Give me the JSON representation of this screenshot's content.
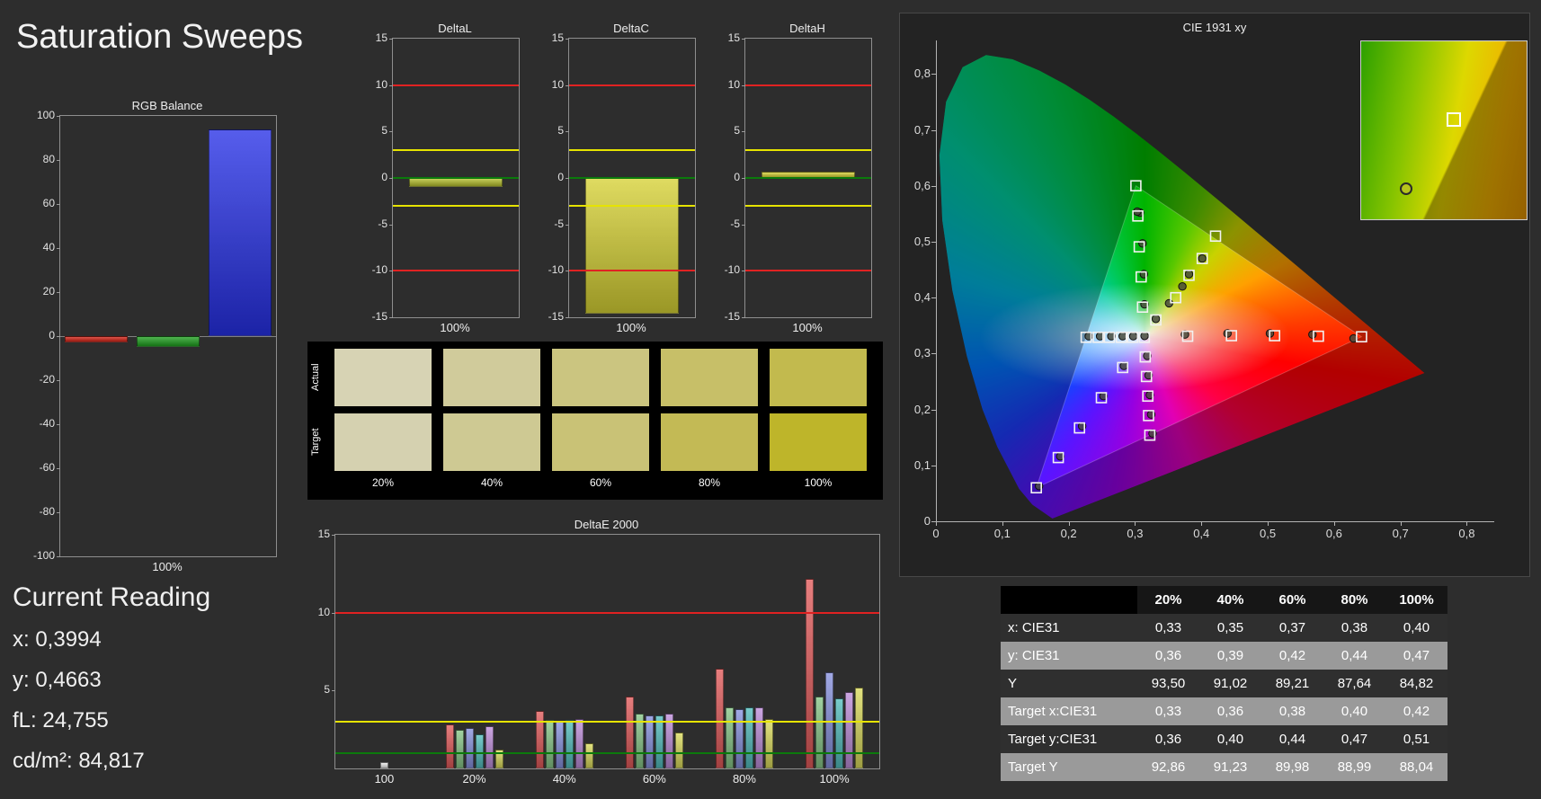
{
  "title": "Saturation Sweeps",
  "current_reading": {
    "heading": "Current Reading",
    "lines": [
      "x: 0,3994",
      "y: 0,4663",
      "fL: 24,755",
      "cd/m²: 84,817"
    ]
  },
  "chart_data": [
    {
      "id": "rgb_balance",
      "type": "bar",
      "title": "RGB Balance",
      "xlabel": "100%",
      "categories": [
        "Red",
        "Green",
        "Blue"
      ],
      "values": [
        -3,
        -5,
        94
      ],
      "colors": [
        "#d42316",
        "#1e9e1e",
        "#2630e6"
      ],
      "ylim": [
        -100,
        100
      ],
      "yticks": [
        "100",
        "80",
        "60",
        "40",
        "20",
        "0",
        "-20",
        "-40",
        "-60",
        "-80",
        "-100"
      ]
    },
    {
      "id": "delta_l",
      "type": "bar",
      "title": "DeltaL",
      "xlabel": "100%",
      "values": [
        -1
      ],
      "bar_color": "#b4be2b",
      "ylim": [
        -15,
        15
      ],
      "yticks": [
        "15",
        "10",
        "5",
        "0",
        "-5",
        "-10",
        "-15"
      ],
      "ref_lines": [
        {
          "y": 10,
          "color": "#e02222"
        },
        {
          "y": -10,
          "color": "#e02222"
        },
        {
          "y": 3,
          "color": "#e6e300"
        },
        {
          "y": -3,
          "color": "#e6e300"
        },
        {
          "y": 0,
          "color": "#0b7a0b"
        }
      ]
    },
    {
      "id": "delta_c",
      "type": "bar",
      "title": "DeltaC",
      "xlabel": "100%",
      "values": [
        -14.6
      ],
      "bar_color": "#d6d134",
      "ylim": [
        -15,
        15
      ],
      "yticks": [
        "15",
        "10",
        "5",
        "0",
        "-5",
        "-10",
        "-15"
      ],
      "ref_lines": [
        {
          "y": 10,
          "color": "#e02222"
        },
        {
          "y": -10,
          "color": "#e02222"
        },
        {
          "y": 3,
          "color": "#e6e300"
        },
        {
          "y": -3,
          "color": "#e6e300"
        },
        {
          "y": 0,
          "color": "#0b7a0b"
        }
      ]
    },
    {
      "id": "delta_h",
      "type": "bar",
      "title": "DeltaH",
      "xlabel": "100%",
      "values": [
        0.7
      ],
      "bar_color": "#d6d134",
      "ylim": [
        -15,
        15
      ],
      "yticks": [
        "15",
        "10",
        "5",
        "0",
        "-5",
        "-10",
        "-15"
      ],
      "ref_lines": [
        {
          "y": 10,
          "color": "#e02222"
        },
        {
          "y": -10,
          "color": "#e02222"
        },
        {
          "y": 3,
          "color": "#e6e300"
        },
        {
          "y": -3,
          "color": "#e6e300"
        },
        {
          "y": 0,
          "color": "#0b7a0b"
        }
      ]
    },
    {
      "id": "delta_e_2000",
      "type": "grouped-bar",
      "title": "DeltaE 2000",
      "categories": [
        "100",
        "20%",
        "40%",
        "60%",
        "80%",
        "100%"
      ],
      "white_bar_color": "#ededed",
      "series_colors": [
        "#e05a5a",
        "#86c586",
        "#8690dc",
        "#52bcbc",
        "#bc8cd8",
        "#dada5c"
      ],
      "groups": [
        [
          0.4
        ],
        [
          2.8,
          2.5,
          2.6,
          2.2,
          2.7,
          1.2
        ],
        [
          3.7,
          3.1,
          3.0,
          3.1,
          3.2,
          1.6
        ],
        [
          4.6,
          3.5,
          3.4,
          3.4,
          3.5,
          2.3
        ],
        [
          6.4,
          3.9,
          3.8,
          3.9,
          3.9,
          3.2
        ],
        [
          12.2,
          4.6,
          6.2,
          4.5,
          4.9,
          5.2
        ]
      ],
      "ylim": [
        0,
        15
      ],
      "yticks": [
        "15",
        "10",
        "5"
      ],
      "ref_lines": [
        {
          "y": 10,
          "color": "#e02222"
        },
        {
          "y": 3,
          "color": "#e6e300"
        },
        {
          "y": 1,
          "color": "#0b7a0b"
        }
      ]
    },
    {
      "id": "cie_1931",
      "type": "scatter",
      "title": "CIE 1931 xy",
      "xlim": [
        0,
        0.84
      ],
      "ylim": [
        0,
        0.86
      ],
      "xticks": [
        "0",
        "0,1",
        "0,2",
        "0,3",
        "0,4",
        "0,5",
        "0,6",
        "0,7",
        "0,8"
      ],
      "yticks": [
        "0",
        "0,1",
        "0,2",
        "0,3",
        "0,4",
        "0,5",
        "0,6",
        "0,7",
        "0,8"
      ],
      "gamut_triangle": [
        [
          0.64,
          0.33
        ],
        [
          0.3,
          0.6
        ],
        [
          0.15,
          0.06
        ]
      ],
      "targets": [
        [
          0.3127,
          0.329
        ],
        [
          0.378,
          0.331
        ],
        [
          0.444,
          0.332
        ],
        [
          0.509,
          0.332
        ],
        [
          0.575,
          0.331
        ],
        [
          0.64,
          0.33
        ],
        [
          0.31,
          0.383
        ],
        [
          0.308,
          0.437
        ],
        [
          0.305,
          0.491
        ],
        [
          0.303,
          0.546
        ],
        [
          0.3,
          0.6
        ],
        [
          0.28,
          0.275
        ],
        [
          0.248,
          0.221
        ],
        [
          0.215,
          0.167
        ],
        [
          0.183,
          0.114
        ],
        [
          0.15,
          0.06
        ],
        [
          0.33,
          0.36
        ],
        [
          0.36,
          0.4
        ],
        [
          0.38,
          0.44
        ],
        [
          0.4,
          0.47
        ],
        [
          0.42,
          0.51
        ],
        [
          0.314,
          0.294
        ],
        [
          0.316,
          0.259
        ],
        [
          0.318,
          0.224
        ],
        [
          0.319,
          0.189
        ],
        [
          0.321,
          0.154
        ],
        [
          0.295,
          0.329
        ],
        [
          0.278,
          0.329
        ],
        [
          0.26,
          0.329
        ],
        [
          0.243,
          0.329
        ],
        [
          0.225,
          0.329
        ]
      ],
      "measurements": [
        [
          0.3131,
          0.3315
        ],
        [
          0.374,
          0.334
        ],
        [
          0.438,
          0.336
        ],
        [
          0.502,
          0.336
        ],
        [
          0.566,
          0.334
        ],
        [
          0.628,
          0.327
        ],
        [
          0.313,
          0.388
        ],
        [
          0.312,
          0.442
        ],
        [
          0.31,
          0.497
        ],
        [
          0.306,
          0.552
        ],
        [
          0.302,
          0.554
        ],
        [
          0.282,
          0.278
        ],
        [
          0.251,
          0.224
        ],
        [
          0.219,
          0.17
        ],
        [
          0.186,
          0.116
        ],
        [
          0.154,
          0.063
        ],
        [
          0.33,
          0.362
        ],
        [
          0.35,
          0.39
        ],
        [
          0.37,
          0.42
        ],
        [
          0.38,
          0.442
        ],
        [
          0.4,
          0.47
        ],
        [
          0.317,
          0.296
        ],
        [
          0.319,
          0.261
        ],
        [
          0.321,
          0.226
        ],
        [
          0.323,
          0.191
        ],
        [
          0.325,
          0.157
        ],
        [
          0.296,
          0.331
        ],
        [
          0.28,
          0.331
        ],
        [
          0.263,
          0.331
        ],
        [
          0.246,
          0.331
        ],
        [
          0.229,
          0.331
        ]
      ],
      "inset": {
        "square": {
          "x": 0.56,
          "y": 0.44
        },
        "circle": {
          "x": 0.27,
          "y": 0.83
        }
      }
    }
  ],
  "swatches": {
    "row_labels": [
      "Actual",
      "Target"
    ],
    "col_labels": [
      "20%",
      "40%",
      "60%",
      "80%",
      "100%"
    ],
    "actual": [
      "#d7d3b4",
      "#d0cb9b",
      "#cbc580",
      "#c7bf68",
      "#c2ba4e"
    ],
    "target": [
      "#d5d1b0",
      "#cec993",
      "#c9c276",
      "#c3ba55",
      "#beb52a"
    ]
  },
  "table": {
    "headers": [
      "",
      "20%",
      "40%",
      "60%",
      "80%",
      "100%"
    ],
    "rows": [
      {
        "label": "x: CIE31",
        "values": [
          "0,33",
          "0,35",
          "0,37",
          "0,38",
          "0,40"
        ]
      },
      {
        "label": "y: CIE31",
        "values": [
          "0,36",
          "0,39",
          "0,42",
          "0,44",
          "0,47"
        ]
      },
      {
        "label": "Y",
        "values": [
          "93,50",
          "91,02",
          "89,21",
          "87,64",
          "84,82"
        ]
      },
      {
        "label": "Target x:CIE31",
        "values": [
          "0,33",
          "0,36",
          "0,38",
          "0,40",
          "0,42"
        ]
      },
      {
        "label": "Target y:CIE31",
        "values": [
          "0,36",
          "0,40",
          "0,44",
          "0,47",
          "0,51"
        ]
      },
      {
        "label": "Target Y",
        "values": [
          "92,86",
          "91,23",
          "89,98",
          "88,99",
          "88,04"
        ]
      }
    ]
  }
}
